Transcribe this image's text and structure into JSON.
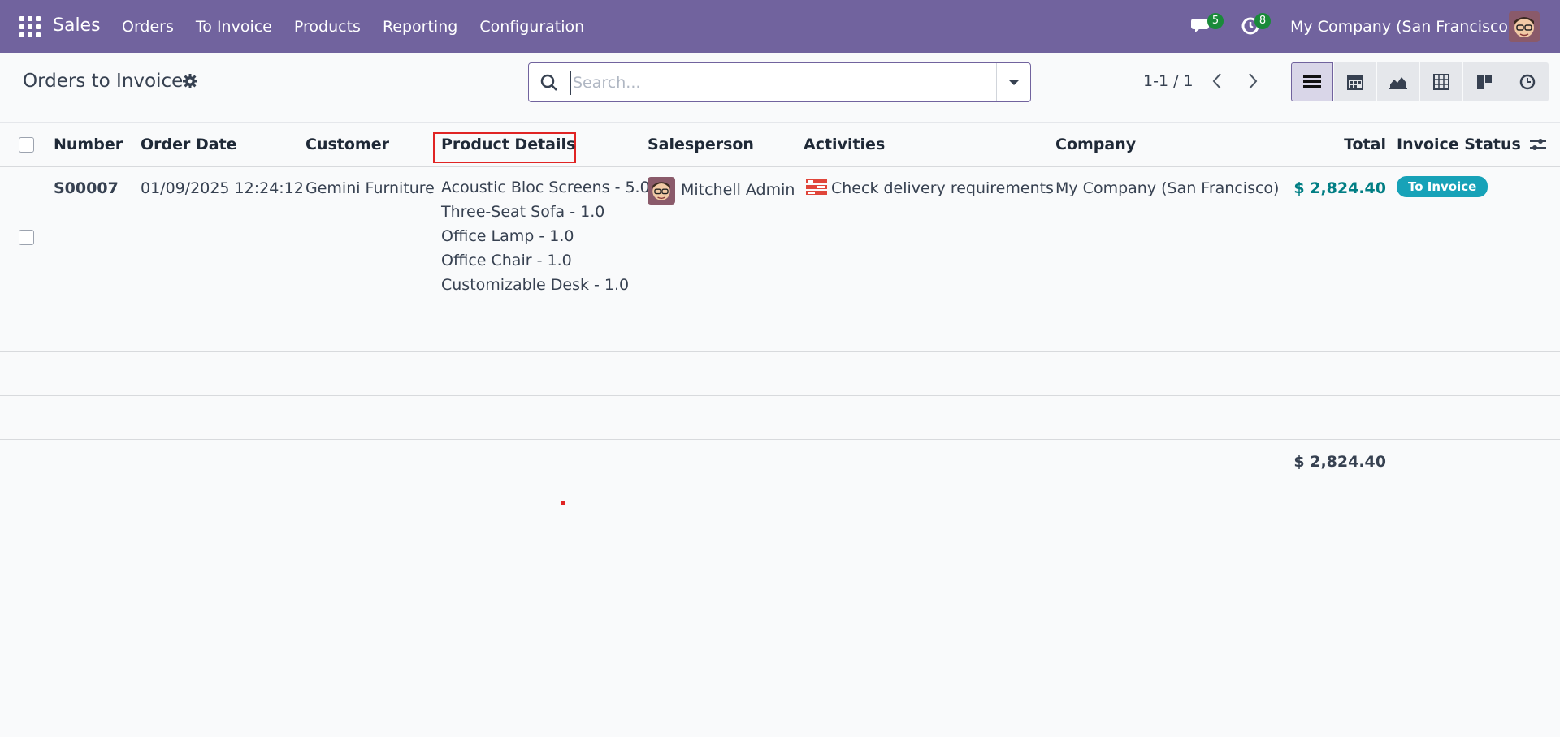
{
  "navbar": {
    "app_name": "Sales",
    "menu": [
      "Orders",
      "To Invoice",
      "Products",
      "Reporting",
      "Configuration"
    ],
    "messages_badge": "5",
    "activities_badge": "8",
    "company": "My Company (San Francisco)"
  },
  "control_panel": {
    "title": "Orders to Invoice",
    "search_placeholder": "Search...",
    "pager": "1-1 / 1",
    "views": [
      "list-icon",
      "calendar-icon",
      "graph-icon",
      "pivot-icon",
      "kanban-icon",
      "activity-icon"
    ]
  },
  "table": {
    "headers": {
      "number": "Number",
      "order_date": "Order Date",
      "customer": "Customer",
      "product_details": "Product Details",
      "salesperson": "Salesperson",
      "activities": "Activities",
      "company": "Company",
      "total": "Total",
      "invoice_status": "Invoice Status"
    },
    "rows": [
      {
        "number": "S00007",
        "order_date": "01/09/2025 12:24:12",
        "customer": "Gemini Furniture",
        "products": [
          "Acoustic Bloc Screens - 5.0",
          "Three-Seat Sofa - 1.0",
          "Office Lamp - 1.0",
          "Office Chair - 1.0",
          "Customizable Desk - 1.0"
        ],
        "salesperson": "Mitchell Admin",
        "activity": "Check delivery requirements",
        "company": "My Company (San Francisco)",
        "total": "$ 2,824.40",
        "invoice_status": "To Invoice"
      }
    ],
    "footer_total": "$ 2,824.40"
  },
  "colors": {
    "navbar": "#71639e",
    "total_text": "#017e84",
    "status_badge": "#17a2b8",
    "highlight": "#e02424"
  }
}
